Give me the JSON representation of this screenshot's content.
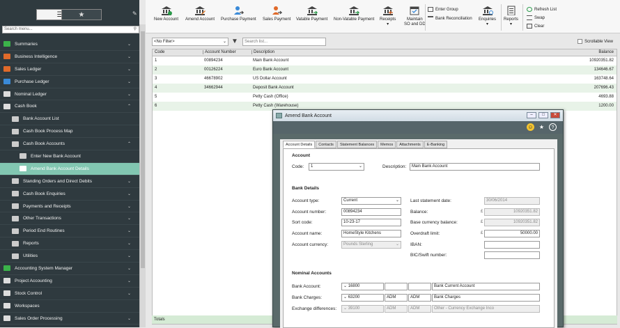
{
  "sidebar": {
    "search_placeholder": "Search menu...",
    "items": [
      {
        "label": "Summaries",
        "icon": "pie-chart-icon",
        "color": "#3bb34a",
        "chev": "⌄",
        "level": 0
      },
      {
        "label": "Business Intelligence",
        "icon": "bi-icon",
        "color": "#e06a2a",
        "chev": "⌄",
        "level": 0
      },
      {
        "label": "Sales Ledger",
        "icon": "person-icon",
        "color": "#e06a2a",
        "chev": "⌄",
        "level": 0
      },
      {
        "label": "Purchase Ledger",
        "icon": "person-icon",
        "color": "#3a8ad8",
        "chev": "⌄",
        "level": 0
      },
      {
        "label": "Nominal Ledger",
        "icon": "book-icon",
        "color": "#dddddd",
        "chev": "⌄",
        "level": 0
      },
      {
        "label": "Cash Book",
        "icon": "cash-icon",
        "color": "#dddddd",
        "chev": "⌃",
        "level": 0
      },
      {
        "label": "Bank Account List",
        "icon": "list-icon",
        "color": "#cccccc",
        "chev": "",
        "level": 1
      },
      {
        "label": "Cash Book Process Map",
        "icon": "map-icon",
        "color": "#cccccc",
        "chev": "",
        "level": 1
      },
      {
        "label": "Cash Book Accounts",
        "icon": "folder-icon",
        "color": "#cccccc",
        "chev": "⌃",
        "level": 1
      },
      {
        "label": "Enter New Bank Account",
        "icon": "form-icon",
        "color": "#cccccc",
        "chev": "",
        "level": 2
      },
      {
        "label": "Amend Bank Account Details",
        "icon": "form-icon",
        "color": "#ffffff",
        "chev": "",
        "level": 2,
        "selected": true
      },
      {
        "label": "Standing Orders and Direct Debits",
        "icon": "folder-icon",
        "color": "#cccccc",
        "chev": "⌄",
        "level": 1
      },
      {
        "label": "Cash Book Enquiries",
        "icon": "folder-icon",
        "color": "#cccccc",
        "chev": "⌄",
        "level": 1
      },
      {
        "label": "Payments and Receipts",
        "icon": "folder-icon",
        "color": "#cccccc",
        "chev": "⌄",
        "level": 1
      },
      {
        "label": "Other Transactions",
        "icon": "folder-icon",
        "color": "#cccccc",
        "chev": "⌄",
        "level": 1
      },
      {
        "label": "Period End Routines",
        "icon": "folder-icon",
        "color": "#cccccc",
        "chev": "⌄",
        "level": 1
      },
      {
        "label": "Reports",
        "icon": "folder-icon",
        "color": "#cccccc",
        "chev": "⌄",
        "level": 1
      },
      {
        "label": "Utilities",
        "icon": "folder-icon",
        "color": "#cccccc",
        "chev": "⌄",
        "level": 1
      },
      {
        "label": "Accounting System Manager",
        "icon": "gear-icon",
        "color": "#3bb34a",
        "chev": "⌄",
        "level": 0
      },
      {
        "label": "Project Accounting",
        "icon": "project-icon",
        "color": "#dddddd",
        "chev": "⌄",
        "level": 0
      },
      {
        "label": "Stock Control",
        "icon": "stock-icon",
        "color": "#dddddd",
        "chev": "⌄",
        "level": 0
      },
      {
        "label": "Workspaces",
        "icon": "globe-icon",
        "color": "#dddddd",
        "chev": "",
        "level": 0
      },
      {
        "label": "Sales Order Processing",
        "icon": "order-icon",
        "color": "#dddddd",
        "chev": "⌄",
        "level": 0
      }
    ]
  },
  "toolbar": {
    "new_account": "New Account",
    "amend_account": "Amend Account",
    "purchase_payment": "Purchase Payment",
    "sales_payment": "Sales Payment",
    "vatable_payment": "Vatable Payment",
    "non_vatable_payment": "Non-Vatable Payment",
    "receipts": "Receipts",
    "maintain_so_dd": "Maintain\nSO and DD",
    "enter_group": "Enter Group",
    "bank_reconciliation": "Bank Reconciliation",
    "enquiries": "Enquiries",
    "reports": "Reports",
    "refresh_list": "Refresh List",
    "swap": "Swap",
    "clear": "Clear",
    "caret": "▾"
  },
  "filter": {
    "selected": "<No Filter>",
    "search_placeholder": "Search list...",
    "scrollable_view": "Scrollable View"
  },
  "grid": {
    "columns": [
      "Code",
      "Account Number",
      "Description",
      "Balance"
    ],
    "rows": [
      [
        "1",
        "00894234",
        "Main Bank Account",
        "10920351.82"
      ],
      [
        "2",
        "00126224",
        "Euro Bank Account",
        "134646.67"
      ],
      [
        "3",
        "46678902",
        "US Dollar Account",
        "163748.64"
      ],
      [
        "4",
        "34662944",
        "Deposit Bank Account",
        "207696.43"
      ],
      [
        "5",
        "",
        "Petty Cash (Office)",
        "4693.88"
      ],
      [
        "6",
        "",
        "Petty Cash (Warehouse)",
        "1200.00"
      ]
    ],
    "totals_label": "Totals"
  },
  "dialog": {
    "title": "Amend Bank Account",
    "tabs": [
      "Account Details",
      "Contacts",
      "Statement Balances",
      "Memos",
      "Attachments",
      "E-Banking"
    ],
    "account_section": "Account",
    "code_label": "Code:",
    "code_value": "1",
    "description_label": "Description:",
    "description_value": "Main Bank Account",
    "bank_details_section": "Bank Details",
    "account_type_label": "Account type:",
    "account_type_value": "Current",
    "account_number_label": "Account number:",
    "account_number_value": "00894234",
    "sort_code_label": "Sort code:",
    "sort_code_value": "10-23-17",
    "account_name_label": "Account name:",
    "account_name_value": "HomeStyle Kitchens",
    "account_currency_label": "Account currency:",
    "account_currency_value": "Pounds Sterling",
    "last_statement_label": "Last statement date:",
    "last_statement_value": "30/06/2014",
    "balance_label": "Balance:",
    "balance_value": "10920351.82",
    "base_balance_label": "Base currency balance:",
    "base_balance_value": "10920351.82",
    "overdraft_label": "Overdraft limit:",
    "overdraft_value": "50000.00",
    "iban_label": "IBAN:",
    "bic_label": "BIC/Swift number:",
    "currency_symbol": "£",
    "nominal_section": "Nominal Accounts",
    "bank_account_label": "Bank Account:",
    "bank_account_code": "16800",
    "bank_account_desc": "Bank Current Account",
    "bank_charges_label": "Bank Charges:",
    "bank_charges_code": "63200",
    "bank_charges_c1": "ADM",
    "bank_charges_c2": "ADM",
    "bank_charges_desc": "Bank Charges",
    "exchange_label": "Exchange differences:",
    "exchange_code": "39100",
    "exchange_c1": "ADM",
    "exchange_c2": "ADM",
    "exchange_desc": "Other - Currency Exchange Inco"
  }
}
